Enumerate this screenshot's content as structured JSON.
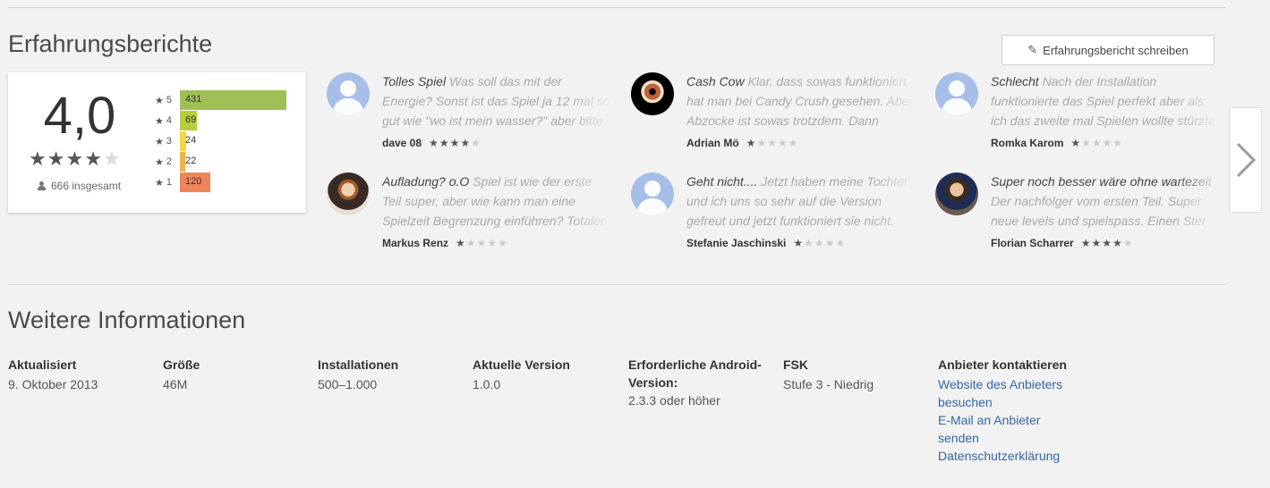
{
  "reviews_section": {
    "title": "Erfahrungsberichte",
    "write_button": "Erfahrungsbericht schreiben"
  },
  "rating_summary": {
    "average": "4,0",
    "average_stars": 4,
    "total": "666 insgesamt",
    "histogram": [
      {
        "star": "5",
        "count": "431",
        "fraction": 0.99,
        "color": "#9fc054"
      },
      {
        "star": "4",
        "count": "69",
        "fraction": 0.16,
        "color": "#b8cd3e"
      },
      {
        "star": "3",
        "count": "24",
        "fraction": 0.06,
        "color": "#f8d543"
      },
      {
        "star": "2",
        "count": "22",
        "fraction": 0.05,
        "color": "#f3b04a"
      },
      {
        "star": "1",
        "count": "120",
        "fraction": 0.28,
        "color": "#f0845a"
      }
    ]
  },
  "reviews": [
    {
      "title": "Tolles Spiel",
      "text": "Was soll das mit der Energie? Sonst ist das Spiel ja 12 mal so gut wie \"wo ist mein wasser?\" aber bitte w",
      "author": "dave 08",
      "stars": 4,
      "avatar": "default"
    },
    {
      "title": "Cash Cow",
      "text": "Klar, dass sowas funktioniert hat man bei Candy Crush gesehen. Aber Abzocke ist sowas trotzdem. Dann",
      "author": "Adrian Mö",
      "stars": 1,
      "avatar": "photo4"
    },
    {
      "title": "Schlecht",
      "text": "Nach der Installation funktionierte das Spiel perfekt aber als ich das zweite mal Spielen wollte stürzte es be",
      "author": "Romka Karom",
      "stars": 1,
      "avatar": "default"
    },
    {
      "title": "Aufladung? o.O",
      "text": "Spiel ist wie der erste Teil super, aber wie kann man eine Spielzeit Begrenzung einführen? Totaler Mis",
      "author": "Markus Renz",
      "stars": 1,
      "avatar": "photo2"
    },
    {
      "title": "Geht nicht....",
      "text": "Jetzt haben meine Tochter und ich uns so sehr auf die Version gefreut und jetzt funktioniert sie nicht.",
      "author": "Stefanie Jaschinski",
      "stars": 1,
      "avatar": "default"
    },
    {
      "title": "Super noch besser wäre ohne wartezeit",
      "text": "Der nachfolger vom ersten Teil. Super neue levels und spielspass. Einen Ster",
      "author": "Florian Scharrer",
      "stars": 4,
      "avatar": "photo3"
    }
  ],
  "next_icon": "chevron-right-icon",
  "info_section": {
    "title": "Weitere Informationen",
    "columns": [
      {
        "heading": "Aktualisiert",
        "value": "9. Oktober 2013"
      },
      {
        "heading": "Größe",
        "value": "46M"
      },
      {
        "heading": "Installationen",
        "value": "500–1.000"
      },
      {
        "heading": "Aktuelle Version",
        "value": "1.0.0"
      },
      {
        "heading_line1": "Erforderliche Android-",
        "heading_line2": "Version:",
        "value": "2.3.3 oder höher"
      },
      {
        "heading": "FSK",
        "value": "Stufe 3 - Niedrig"
      },
      {
        "heading": "Anbieter kontaktieren",
        "links": [
          {
            "line1": "Website des Anbieters",
            "line2": "besuchen"
          },
          {
            "line1": "E-Mail an Anbieter",
            "line2": "senden"
          },
          {
            "line1": "Datenschutzerklärung"
          }
        ]
      }
    ]
  }
}
